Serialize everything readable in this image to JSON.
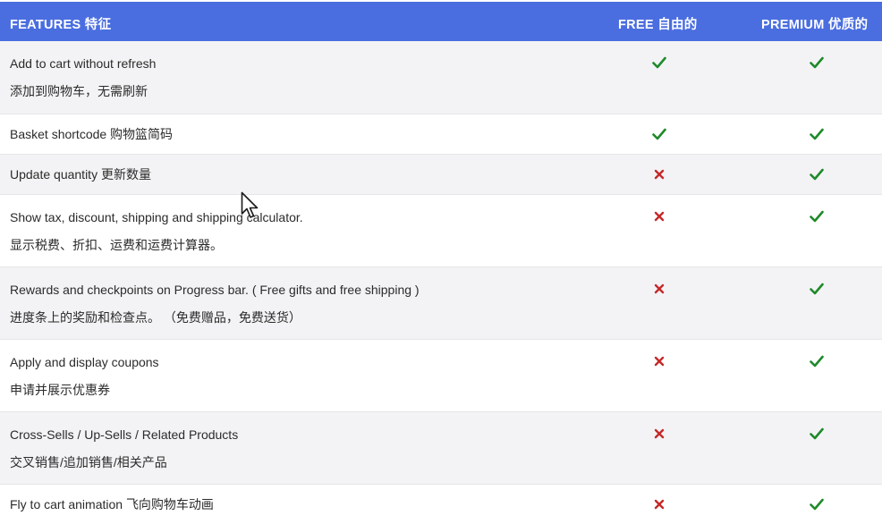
{
  "header": {
    "features": "FEATURES  特征",
    "free": "FREE  自由的",
    "premium": "PREMIUM  优质的"
  },
  "colors": {
    "header_bg": "#4a6ee0",
    "check": "#1e8a2a",
    "cross": "#c62828",
    "row_alt": "#f3f3f5"
  },
  "rows": [
    {
      "en": "Add to cart without refresh",
      "zh": "添加到购物车，无需刷新",
      "free": "check-icon",
      "premium": "check-icon"
    },
    {
      "en": "Basket shortcode  购物篮简码",
      "zh": "",
      "free": "check-icon",
      "premium": "check-icon"
    },
    {
      "en": "Update quantity  更新数量",
      "zh": "",
      "free": "cross-icon",
      "premium": "check-icon"
    },
    {
      "en": "Show tax, discount, shipping and shipping calculator.",
      "zh": "显示税费、折扣、运费和运费计算器。",
      "free": "cross-icon",
      "premium": "check-icon"
    },
    {
      "en": "Rewards and checkpoints on Progress bar. ( Free gifts and free shipping )",
      "zh": "进度条上的奖励和检查点。 （免费赠品，免费送货）",
      "free": "cross-icon",
      "premium": "check-icon"
    },
    {
      "en": "Apply and display coupons",
      "zh": "申请并展示优惠券",
      "free": "cross-icon",
      "premium": "check-icon"
    },
    {
      "en": "Cross-Sells / Up-Sells / Related Products",
      "zh": "交叉销售/追加销售/相关产品",
      "free": "cross-icon",
      "premium": "check-icon"
    },
    {
      "en": "Fly to cart animation  飞向购物车动画",
      "zh": "",
      "free": "cross-icon",
      "premium": "check-icon"
    }
  ]
}
